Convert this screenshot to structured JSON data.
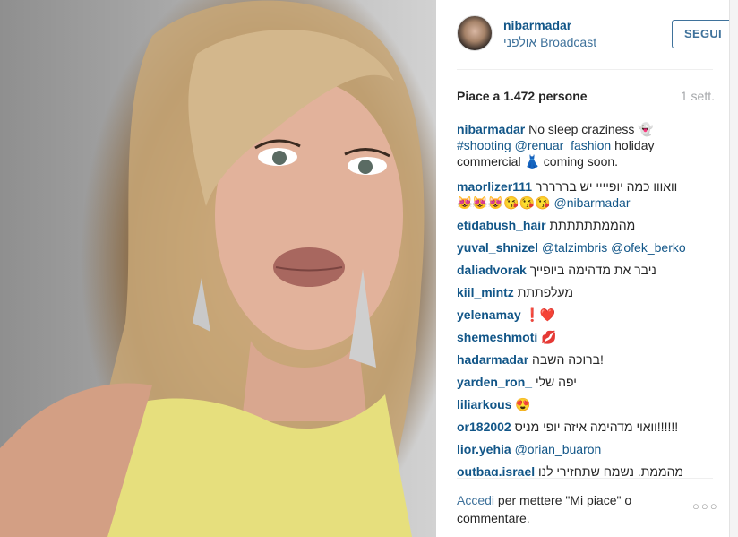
{
  "photo": {
    "description_icon": "selfie-photo"
  },
  "header": {
    "username": "nibarmadar",
    "location": "אולפני Broadcast",
    "follow_label": "SEGUI"
  },
  "stats": {
    "likes": "Piace a 1.472 persone",
    "time": "1 sett."
  },
  "caption": {
    "user": "nibarmadar",
    "text1": "No sleep craziness 👻",
    "tag1": "#shooting",
    "tag2": "@renuar_fashion",
    "text2": "holiday",
    "text3": "commercial 👗 coming soon."
  },
  "comments": [
    {
      "user": "maorlizer111",
      "text": "וואווו כמה יופיייי יש בררררר",
      "text2": "😻😻😻😘😘😘",
      "tag": "@nibarmadar"
    },
    {
      "user": "etidabush_hair",
      "text": "מהממתתתתתת"
    },
    {
      "user": "yuval_shnizel",
      "tag": "@talzimbris @ofek_berko"
    },
    {
      "user": "daliadvorak",
      "text": "ניבר את מדהימה ביופייך"
    },
    {
      "user": "kiil_mintz",
      "text": "מעלפתתת"
    },
    {
      "user": "yelenamay",
      "text": "❗❤️"
    },
    {
      "user": "shemeshmoti",
      "text": "💋"
    },
    {
      "user": "hadarmadar",
      "text": "ברוכה השבה!"
    },
    {
      "user": "yarden_ron_",
      "text": "יפה שלי"
    },
    {
      "user": "liliarkous",
      "text": "😍"
    },
    {
      "user": "or182002",
      "text": "וואוי מדהימה איזה יופי מניס!!!!!!"
    },
    {
      "user": "lior.yehia",
      "tag": "@orian_buaron"
    },
    {
      "user": "outbag.israel",
      "text": "מהממת. נשמח שתחזירי לנו"
    }
  ],
  "footer": {
    "login_link": "Accedi",
    "rest": "per mettere \"Mi piace\" o commentare.",
    "more_label": "○○○"
  }
}
